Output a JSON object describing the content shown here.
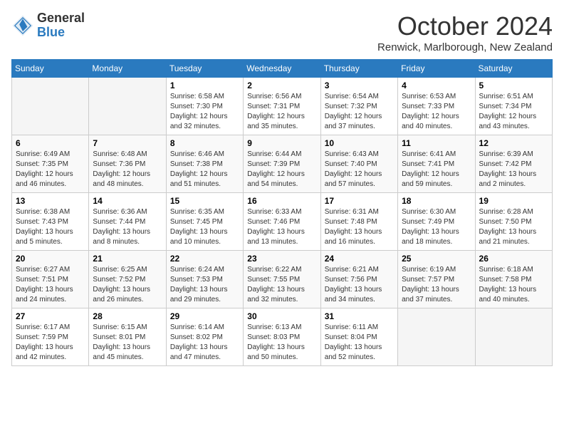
{
  "header": {
    "logo_general": "General",
    "logo_blue": "Blue",
    "title": "October 2024",
    "location": "Renwick, Marlborough, New Zealand"
  },
  "days_of_week": [
    "Sunday",
    "Monday",
    "Tuesday",
    "Wednesday",
    "Thursday",
    "Friday",
    "Saturday"
  ],
  "weeks": [
    [
      {
        "day": "",
        "detail": ""
      },
      {
        "day": "",
        "detail": ""
      },
      {
        "day": "1",
        "detail": "Sunrise: 6:58 AM\nSunset: 7:30 PM\nDaylight: 12 hours and 32 minutes."
      },
      {
        "day": "2",
        "detail": "Sunrise: 6:56 AM\nSunset: 7:31 PM\nDaylight: 12 hours and 35 minutes."
      },
      {
        "day": "3",
        "detail": "Sunrise: 6:54 AM\nSunset: 7:32 PM\nDaylight: 12 hours and 37 minutes."
      },
      {
        "day": "4",
        "detail": "Sunrise: 6:53 AM\nSunset: 7:33 PM\nDaylight: 12 hours and 40 minutes."
      },
      {
        "day": "5",
        "detail": "Sunrise: 6:51 AM\nSunset: 7:34 PM\nDaylight: 12 hours and 43 minutes."
      }
    ],
    [
      {
        "day": "6",
        "detail": "Sunrise: 6:49 AM\nSunset: 7:35 PM\nDaylight: 12 hours and 46 minutes."
      },
      {
        "day": "7",
        "detail": "Sunrise: 6:48 AM\nSunset: 7:36 PM\nDaylight: 12 hours and 48 minutes."
      },
      {
        "day": "8",
        "detail": "Sunrise: 6:46 AM\nSunset: 7:38 PM\nDaylight: 12 hours and 51 minutes."
      },
      {
        "day": "9",
        "detail": "Sunrise: 6:44 AM\nSunset: 7:39 PM\nDaylight: 12 hours and 54 minutes."
      },
      {
        "day": "10",
        "detail": "Sunrise: 6:43 AM\nSunset: 7:40 PM\nDaylight: 12 hours and 57 minutes."
      },
      {
        "day": "11",
        "detail": "Sunrise: 6:41 AM\nSunset: 7:41 PM\nDaylight: 12 hours and 59 minutes."
      },
      {
        "day": "12",
        "detail": "Sunrise: 6:39 AM\nSunset: 7:42 PM\nDaylight: 13 hours and 2 minutes."
      }
    ],
    [
      {
        "day": "13",
        "detail": "Sunrise: 6:38 AM\nSunset: 7:43 PM\nDaylight: 13 hours and 5 minutes."
      },
      {
        "day": "14",
        "detail": "Sunrise: 6:36 AM\nSunset: 7:44 PM\nDaylight: 13 hours and 8 minutes."
      },
      {
        "day": "15",
        "detail": "Sunrise: 6:35 AM\nSunset: 7:45 PM\nDaylight: 13 hours and 10 minutes."
      },
      {
        "day": "16",
        "detail": "Sunrise: 6:33 AM\nSunset: 7:46 PM\nDaylight: 13 hours and 13 minutes."
      },
      {
        "day": "17",
        "detail": "Sunrise: 6:31 AM\nSunset: 7:48 PM\nDaylight: 13 hours and 16 minutes."
      },
      {
        "day": "18",
        "detail": "Sunrise: 6:30 AM\nSunset: 7:49 PM\nDaylight: 13 hours and 18 minutes."
      },
      {
        "day": "19",
        "detail": "Sunrise: 6:28 AM\nSunset: 7:50 PM\nDaylight: 13 hours and 21 minutes."
      }
    ],
    [
      {
        "day": "20",
        "detail": "Sunrise: 6:27 AM\nSunset: 7:51 PM\nDaylight: 13 hours and 24 minutes."
      },
      {
        "day": "21",
        "detail": "Sunrise: 6:25 AM\nSunset: 7:52 PM\nDaylight: 13 hours and 26 minutes."
      },
      {
        "day": "22",
        "detail": "Sunrise: 6:24 AM\nSunset: 7:53 PM\nDaylight: 13 hours and 29 minutes."
      },
      {
        "day": "23",
        "detail": "Sunrise: 6:22 AM\nSunset: 7:55 PM\nDaylight: 13 hours and 32 minutes."
      },
      {
        "day": "24",
        "detail": "Sunrise: 6:21 AM\nSunset: 7:56 PM\nDaylight: 13 hours and 34 minutes."
      },
      {
        "day": "25",
        "detail": "Sunrise: 6:19 AM\nSunset: 7:57 PM\nDaylight: 13 hours and 37 minutes."
      },
      {
        "day": "26",
        "detail": "Sunrise: 6:18 AM\nSunset: 7:58 PM\nDaylight: 13 hours and 40 minutes."
      }
    ],
    [
      {
        "day": "27",
        "detail": "Sunrise: 6:17 AM\nSunset: 7:59 PM\nDaylight: 13 hours and 42 minutes."
      },
      {
        "day": "28",
        "detail": "Sunrise: 6:15 AM\nSunset: 8:01 PM\nDaylight: 13 hours and 45 minutes."
      },
      {
        "day": "29",
        "detail": "Sunrise: 6:14 AM\nSunset: 8:02 PM\nDaylight: 13 hours and 47 minutes."
      },
      {
        "day": "30",
        "detail": "Sunrise: 6:13 AM\nSunset: 8:03 PM\nDaylight: 13 hours and 50 minutes."
      },
      {
        "day": "31",
        "detail": "Sunrise: 6:11 AM\nSunset: 8:04 PM\nDaylight: 13 hours and 52 minutes."
      },
      {
        "day": "",
        "detail": ""
      },
      {
        "day": "",
        "detail": ""
      }
    ]
  ]
}
